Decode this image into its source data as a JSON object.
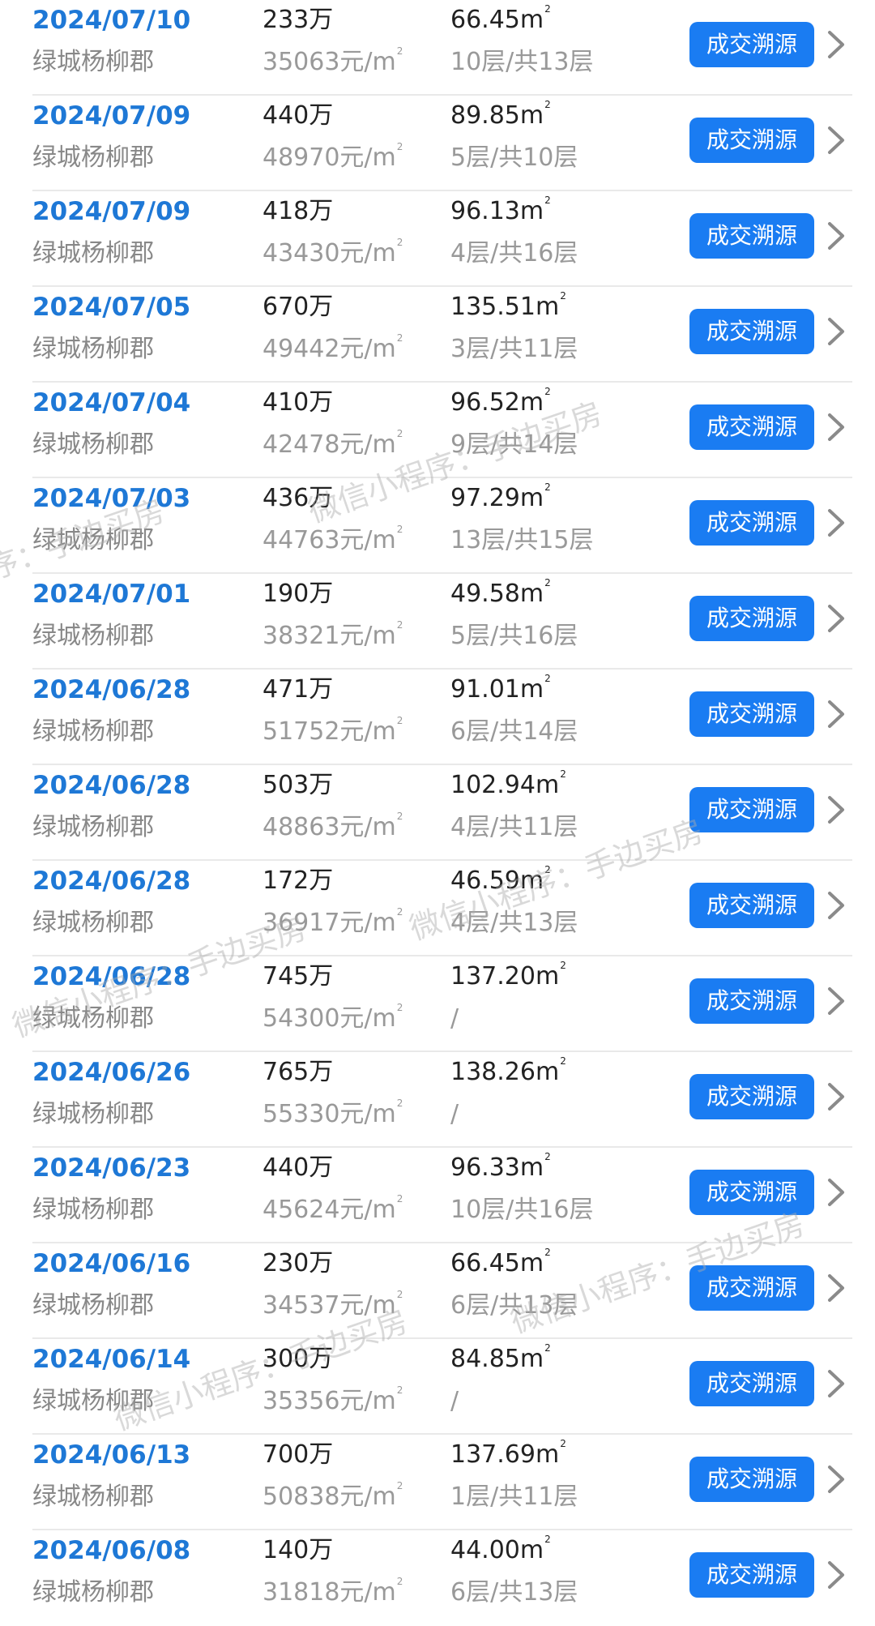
{
  "square_meter_mark": "2",
  "trace_button_label": "成交溯源",
  "watermark_text": "微信小程序：手边买房",
  "transactions": [
    {
      "date": "2024/07/10",
      "community": "绿城杨柳郡",
      "total_price": "233万",
      "unit_price": "35063元/m",
      "area": "66.45m",
      "floor": "10层/共13层"
    },
    {
      "date": "2024/07/09",
      "community": "绿城杨柳郡",
      "total_price": "440万",
      "unit_price": "48970元/m",
      "area": "89.85m",
      "floor": "5层/共10层"
    },
    {
      "date": "2024/07/09",
      "community": "绿城杨柳郡",
      "total_price": "418万",
      "unit_price": "43430元/m",
      "area": "96.13m",
      "floor": "4层/共16层"
    },
    {
      "date": "2024/07/05",
      "community": "绿城杨柳郡",
      "total_price": "670万",
      "unit_price": "49442元/m",
      "area": "135.51m",
      "floor": "3层/共11层"
    },
    {
      "date": "2024/07/04",
      "community": "绿城杨柳郡",
      "total_price": "410万",
      "unit_price": "42478元/m",
      "area": "96.52m",
      "floor": "9层/共14层"
    },
    {
      "date": "2024/07/03",
      "community": "绿城杨柳郡",
      "total_price": "436万",
      "unit_price": "44763元/m",
      "area": "97.29m",
      "floor": "13层/共15层"
    },
    {
      "date": "2024/07/01",
      "community": "绿城杨柳郡",
      "total_price": "190万",
      "unit_price": "38321元/m",
      "area": "49.58m",
      "floor": "5层/共16层"
    },
    {
      "date": "2024/06/28",
      "community": "绿城杨柳郡",
      "total_price": "471万",
      "unit_price": "51752元/m",
      "area": "91.01m",
      "floor": "6层/共14层"
    },
    {
      "date": "2024/06/28",
      "community": "绿城杨柳郡",
      "total_price": "503万",
      "unit_price": "48863元/m",
      "area": "102.94m",
      "floor": "4层/共11层"
    },
    {
      "date": "2024/06/28",
      "community": "绿城杨柳郡",
      "total_price": "172万",
      "unit_price": "36917元/m",
      "area": "46.59m",
      "floor": "4层/共13层"
    },
    {
      "date": "2024/06/28",
      "community": "绿城杨柳郡",
      "total_price": "745万",
      "unit_price": "54300元/m",
      "area": "137.20m",
      "floor": "/"
    },
    {
      "date": "2024/06/26",
      "community": "绿城杨柳郡",
      "total_price": "765万",
      "unit_price": "55330元/m",
      "area": "138.26m",
      "floor": "/"
    },
    {
      "date": "2024/06/23",
      "community": "绿城杨柳郡",
      "total_price": "440万",
      "unit_price": "45624元/m",
      "area": "96.33m",
      "floor": "10层/共16层"
    },
    {
      "date": "2024/06/16",
      "community": "绿城杨柳郡",
      "total_price": "230万",
      "unit_price": "34537元/m",
      "area": "66.45m",
      "floor": "6层/共13层"
    },
    {
      "date": "2024/06/14",
      "community": "绿城杨柳郡",
      "total_price": "300万",
      "unit_price": "35356元/m",
      "area": "84.85m",
      "floor": "/"
    },
    {
      "date": "2024/06/13",
      "community": "绿城杨柳郡",
      "total_price": "700万",
      "unit_price": "50838元/m",
      "area": "137.69m",
      "floor": "1层/共11层"
    },
    {
      "date": "2024/06/08",
      "community": "绿城杨柳郡",
      "total_price": "140万",
      "unit_price": "31818元/m",
      "area": "44.00m",
      "floor": "6层/共13层"
    }
  ]
}
